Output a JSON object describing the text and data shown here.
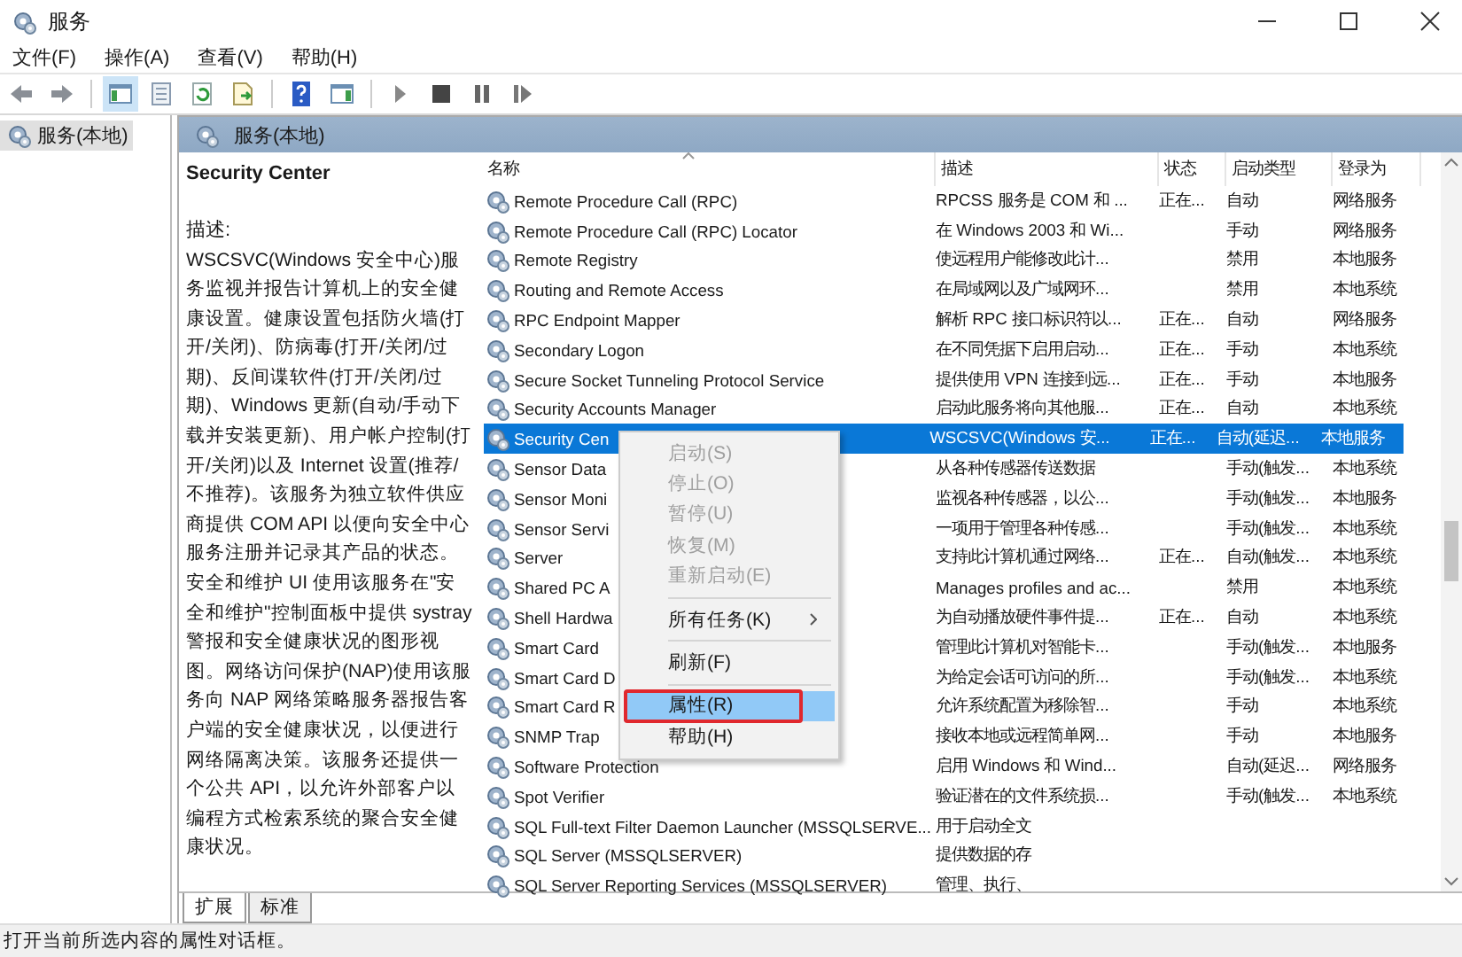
{
  "window": {
    "title": "服务"
  },
  "menu_bar": [
    "文件(F)",
    "操作(A)",
    "查看(V)",
    "帮助(H)"
  ],
  "tree": {
    "items": [
      {
        "label": "服务(本地)",
        "selected": true
      }
    ]
  },
  "pane_header": "服务(本地)",
  "details": {
    "title": "Security Center",
    "label": "描述:",
    "text": "WSCSVC(Windows 安全中心)服务监视并报告计算机上的安全健康设置。健康设置包括防火墙(打开/关闭)、防病毒(打开/关闭/过期)、反间谍软件(打开/关闭/过期)、Windows 更新(自动/手动下载并安装更新)、用户帐户控制(打开/关闭)以及 Internet 设置(推荐/不推荐)。该服务为独立软件供应商提供 COM API 以便向安全中心服务注册并记录其产品的状态。安全和维护 UI 使用该服务在\"安全和维护\"控制面板中提供 systray 警报和安全健康状况的图形视图。网络访问保护(NAP)使用该服务向 NAP 网络策略服务器报告客户端的安全健康状况，以便进行网络隔离决策。该服务还提供一个公共 API，以允许外部客户以编程方式检索系统的聚合安全健康状况。"
  },
  "table": {
    "columns": [
      "名称",
      "描述",
      "状态",
      "启动类型",
      "登录为"
    ],
    "rows": [
      {
        "name": "Remote Procedure Call (RPC)",
        "description": "RPCSS 服务是 COM 和 ...",
        "status": "正在...",
        "startup_type": "自动",
        "logon_as": "网络服务",
        "selected": false
      },
      {
        "name": "Remote Procedure Call (RPC) Locator",
        "description": "在 Windows 2003 和 Wi...",
        "startup_type": "手动",
        "logon_as": "网络服务",
        "selected": false
      },
      {
        "name": "Remote Registry",
        "description": "使远程用户能修改此计...",
        "startup_type": "禁用",
        "logon_as": "本地服务",
        "selected": false
      },
      {
        "name": "Routing and Remote Access",
        "description": "在局域网以及广域网环...",
        "startup_type": "禁用",
        "logon_as": "本地系统",
        "selected": false
      },
      {
        "name": "RPC Endpoint Mapper",
        "description": "解析 RPC 接口标识符以...",
        "status": "正在...",
        "startup_type": "自动",
        "logon_as": "网络服务",
        "selected": false
      },
      {
        "name": "Secondary Logon",
        "description": "在不同凭据下启用启动...",
        "status": "正在...",
        "startup_type": "手动",
        "logon_as": "本地系统",
        "selected": false
      },
      {
        "name": "Secure Socket Tunneling Protocol Service",
        "description": "提供使用 VPN 连接到远...",
        "status": "正在...",
        "startup_type": "手动",
        "logon_as": "本地服务",
        "selected": false
      },
      {
        "name": "Security Accounts Manager",
        "description": "启动此服务将向其他服...",
        "status": "正在...",
        "startup_type": "自动",
        "logon_as": "本地系统",
        "selected": false
      },
      {
        "name": "Security Cen",
        "description": "WSCSVC(Windows 安...",
        "status": "正在...",
        "startup_type": "自动(延迟...",
        "logon_as": "本地服务",
        "selected": true
      },
      {
        "name": "Sensor Data",
        "description": "从各种传感器传送数据",
        "startup_type": "手动(触发...",
        "logon_as": "本地系统",
        "selected": false
      },
      {
        "name": "Sensor Moni",
        "description": "监视各种传感器，以公...",
        "startup_type": "手动(触发...",
        "logon_as": "本地服务",
        "selected": false
      },
      {
        "name": "Sensor Servi",
        "description": "一项用于管理各种传感...",
        "startup_type": "手动(触发...",
        "logon_as": "本地系统",
        "selected": false
      },
      {
        "name": "Server",
        "description": "支持此计算机通过网络...",
        "status": "正在...",
        "startup_type": "自动(触发...",
        "logon_as": "本地系统",
        "selected": false
      },
      {
        "name": "Shared PC A",
        "description": "Manages profiles and ac...",
        "startup_type": "禁用",
        "logon_as": "本地系统",
        "selected": false
      },
      {
        "name": "Shell Hardwa",
        "description": "为自动播放硬件事件提...",
        "status": "正在...",
        "startup_type": "自动",
        "logon_as": "本地系统",
        "selected": false
      },
      {
        "name": "Smart Card",
        "description": "管理此计算机对智能卡...",
        "startup_type": "手动(触发...",
        "logon_as": "本地服务",
        "selected": false
      },
      {
        "name": "Smart Card D",
        "description": "为给定会话可访问的所...",
        "startup_type": "手动(触发...",
        "logon_as": "本地系统",
        "selected": false
      },
      {
        "name": "Smart Card R",
        "description": "允许系统配置为移除智...",
        "startup_type": "手动",
        "logon_as": "本地系统",
        "selected": false
      },
      {
        "name": "SNMP Trap",
        "description": "接收本地或远程简单网...",
        "startup_type": "手动",
        "logon_as": "本地服务",
        "selected": false
      },
      {
        "name": "Software Protection",
        "description": "启用 Windows 和 Wind...",
        "startup_type": "自动(延迟...",
        "logon_as": "网络服务",
        "selected": false
      },
      {
        "name": "Spot Verifier",
        "description": "验证潜在的文件系统损...",
        "startup_type": "手动(触发...",
        "logon_as": "本地系统",
        "selected": false
      },
      {
        "name": "SQL Full-text Filter Daemon Launcher (MSSQLSERVE...",
        "description": "用于启动全文",
        "selected": false
      },
      {
        "name": "SQL Server (MSSQLSERVER)",
        "description": "提供数据的存",
        "selected": false
      },
      {
        "name": "SQL Server Reporting Services (MSSQLSERVER)",
        "description": "管理、执行、",
        "selected": false
      }
    ]
  },
  "context_menu": [
    {
      "kind": "item",
      "label": "启动(S)",
      "disabled": true,
      "highlighted": false,
      "marked": false
    },
    {
      "kind": "item",
      "label": "停止(O)",
      "disabled": true,
      "highlighted": false,
      "marked": false
    },
    {
      "kind": "item",
      "label": "暂停(U)",
      "disabled": true,
      "highlighted": false,
      "marked": false
    },
    {
      "kind": "item",
      "label": "恢复(M)",
      "disabled": true,
      "highlighted": false,
      "marked": false
    },
    {
      "kind": "item",
      "label": "重新启动(E)",
      "disabled": true,
      "highlighted": false,
      "marked": false
    },
    {
      "kind": "separator"
    },
    {
      "kind": "submenu",
      "label": "所有任务(K)",
      "disabled": false,
      "highlighted": false,
      "marked": false
    },
    {
      "kind": "separator"
    },
    {
      "kind": "item",
      "label": "刷新(F)",
      "disabled": false,
      "highlighted": false,
      "marked": false
    },
    {
      "kind": "separator"
    },
    {
      "kind": "item",
      "label": "属性(R)",
      "disabled": false,
      "highlighted": true,
      "marked": true
    },
    {
      "kind": "item",
      "label": "帮助(H)",
      "disabled": false,
      "highlighted": false,
      "marked": false
    }
  ],
  "bottom_tabs": [
    {
      "label": "扩展",
      "selected": true
    },
    {
      "label": "标准",
      "selected": false
    }
  ],
  "status_bar": "打开当前所选内容的属性对话框。"
}
